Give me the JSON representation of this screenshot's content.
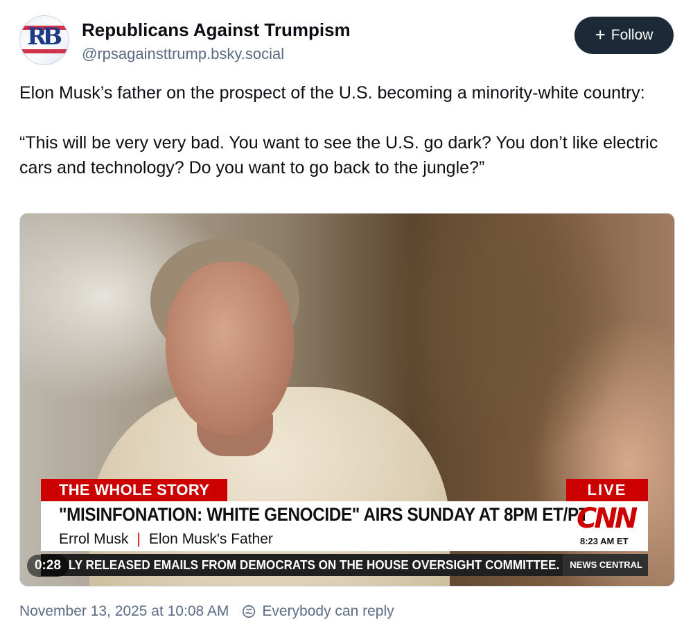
{
  "author": {
    "display_name": "Republicans Against Trumpism",
    "handle": "@rpsagainsttrump.bsky.social",
    "avatar_text": "RB"
  },
  "follow_button": {
    "label": "Follow"
  },
  "post": {
    "paragraph1": "Elon Musk’s father on the prospect of the U.S. becoming a minority-white country:",
    "paragraph2": "“This will be very very bad. You want to see the U.S. go dark? You don’t like electric cars and technology? Do you want to go back to the jungle?”"
  },
  "video": {
    "timecode": "0:28",
    "banner_left": "THE WHOLE STORY",
    "banner_live": "LIVE",
    "headline": "\"MISINFONATION: WHITE GENOCIDE\" AIRS SUNDAY AT 8PM ET/PT",
    "subject_name": "Errol Musk",
    "subject_title": "Elon Musk's Father",
    "network_logo": "CNN",
    "clock": "8:23 AM ET",
    "ticker": "LY RELEASED EMAILS FROM DEMOCRATS ON THE HOUSE OVERSIGHT COMMITTEE.",
    "ticker_brand": "NEWS CENTRAL"
  },
  "footer": {
    "timestamp": "November 13, 2025 at 10:08 AM",
    "reply_setting": "Everybody can reply",
    "reply_icon": "globe-reply-icon"
  },
  "colors": {
    "follow_bg": "#1c2936",
    "meta_text": "#5b6b82",
    "cnn_red": "#cc0000"
  }
}
